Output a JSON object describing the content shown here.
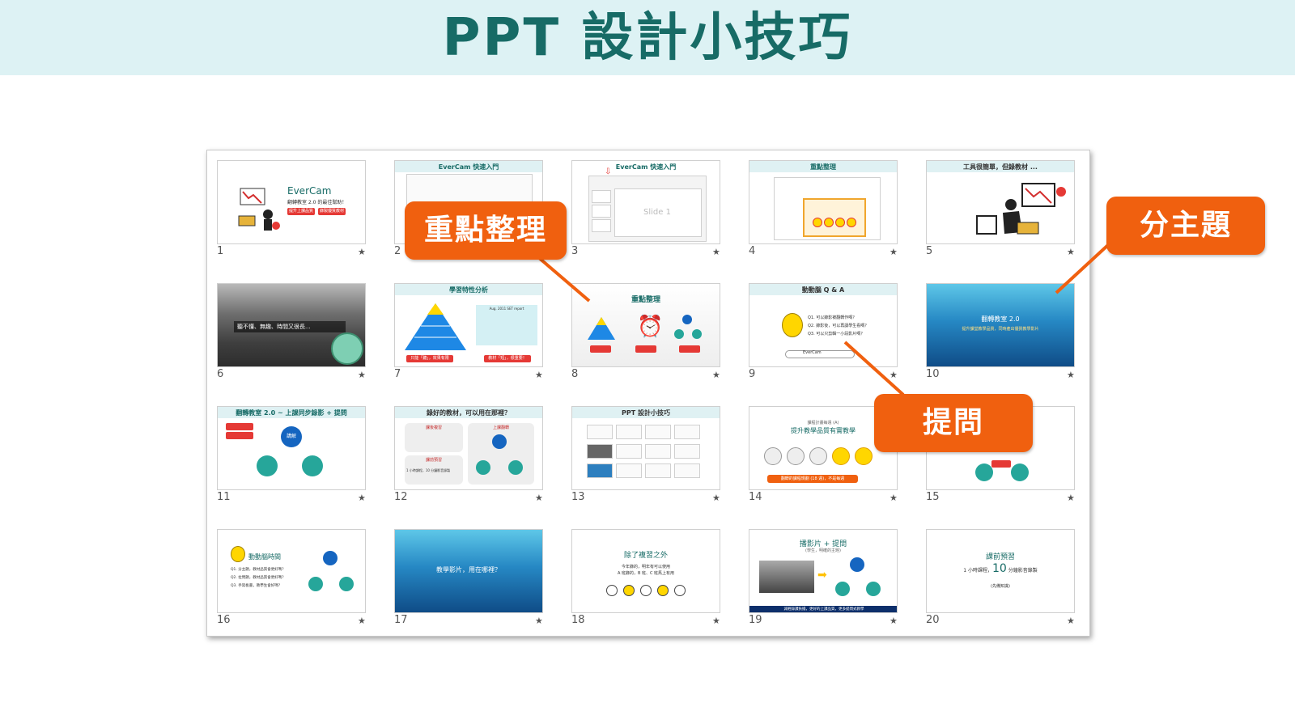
{
  "header": {
    "title": "PPT 設計小技巧"
  },
  "callouts": {
    "key_points": "重點整理",
    "sub_topic": "分主題",
    "question": "提問"
  },
  "slides": [
    {
      "num": "1",
      "star": "★"
    },
    {
      "num": "2",
      "star": "★"
    },
    {
      "num": "3",
      "star": "★"
    },
    {
      "num": "4",
      "star": "★"
    },
    {
      "num": "5",
      "star": "★"
    },
    {
      "num": "6",
      "star": "★"
    },
    {
      "num": "7",
      "star": "★"
    },
    {
      "num": "8",
      "star": "★"
    },
    {
      "num": "9",
      "star": "★"
    },
    {
      "num": "10",
      "star": "★"
    },
    {
      "num": "11",
      "star": "★"
    },
    {
      "num": "12",
      "star": "★"
    },
    {
      "num": "13",
      "star": "★"
    },
    {
      "num": "14",
      "star": "★"
    },
    {
      "num": "15",
      "star": "★"
    },
    {
      "num": "16",
      "star": "★"
    },
    {
      "num": "17",
      "star": "★"
    },
    {
      "num": "18",
      "star": "★"
    },
    {
      "num": "19",
      "star": "★"
    },
    {
      "num": "20",
      "star": "★"
    }
  ],
  "slide_text": {
    "s1_title": "EverCam",
    "s1_sub": "翻轉教室 2.0 的最佳幫助！",
    "s1_tag1": "提升上課品質",
    "s1_tag2": "錄製優質教材",
    "s2_title": "EverCam 快速入門",
    "s3_title": "EverCam 快速入門",
    "s3_slide": "Slide 1",
    "s4_title": "重點整理",
    "s5_title": "工具很簡單，但錄教材 ...",
    "s6_text": "聽不懂、無趣、時間又很長...",
    "s7_title": "學習特性分析",
    "s7_report": "Aug. 2011 SET report",
    "s7_tag1": "只能「聽」，效果有限",
    "s7_tag2": "教材「短」，很重要！",
    "s8_title": "重點整理",
    "s9_title": "動動腦 Q & A",
    "s9_q1": "Q1. 可以錄影被翻轉作嗎？",
    "s9_q2": "Q2. 錄影後，可以再讓學生看嗎？",
    "s9_q3": "Q3. 可以只剪輯一小段影片嗎？",
    "s9_search": "EverCam",
    "s10_title": "翻轉教室 2.0",
    "s10_sub": "提升課堂教學品質，同時產出優質教學影片",
    "s11_title": "翻轉教室 2.0 ~ 上課同步錄影 + 提問",
    "s11_center": "講解",
    "s12_title": "錄好的教材，可以用在那裡？",
    "s12_box1": "課後複習",
    "s12_box2": "課前預習",
    "s12_box3": "上課翻轉",
    "s12_min": "1 小時課程，10 分鐘影音錄製",
    "s13_title": "PPT 設計小技巧",
    "s14_sub": "課程計畫每週 (A)",
    "s14_title": "提升教學品質有實教學",
    "s14_bar": "翻轉的課程規劃 (18 週)，不是每週",
    "s16_title": "動動腦時間",
    "s16_q1": "Q1. 分主題，教材品質會更好嗎？",
    "s16_q2": "Q2. 拉問題，教材品質會更好嗎？",
    "s16_q3": "Q3. 手寫板書，教學生會好嗎？",
    "s17_text": "教學影片，用在哪裡？",
    "s18_title": "除了複習之外",
    "s18_l1": "今年錄的，明年有可以使用",
    "s18_l2": "A 班錄的，B 班、C 班馬上有用",
    "s19_title": "播影片 + 提問",
    "s19_sub": "(學生，明確的主題)",
    "s19_bar": "減輕錄課負擔，更好的上課品質，更多提問式教學",
    "s20_title": "課前預習",
    "s20_line_pre": "1 小時課程，",
    "s20_big": "10",
    "s20_line_post": " 分鐘影音錄製",
    "s20_note": "(先備知識)"
  },
  "colors": {
    "accent": "#f0600f",
    "teal": "#176b66",
    "header_bg": "#ddf2f4",
    "blue": "#1b6fae"
  }
}
